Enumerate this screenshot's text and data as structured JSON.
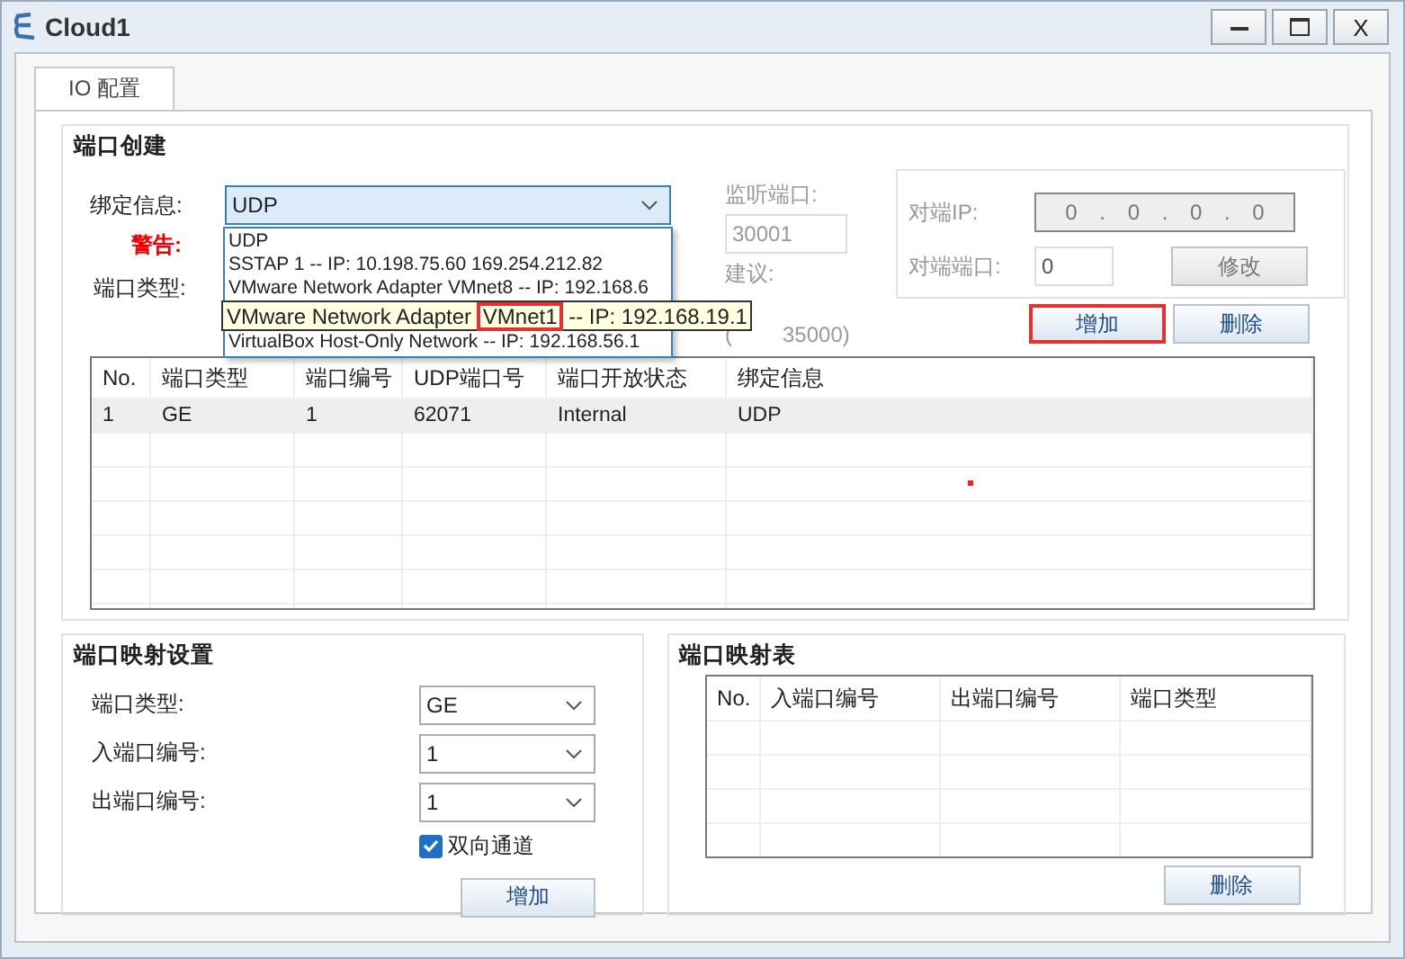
{
  "window": {
    "title": "Cloud1",
    "close_label": "X"
  },
  "tabs": [
    {
      "label": "IO 配置",
      "selected": true
    }
  ],
  "port_creation": {
    "title": "端口创建",
    "binding": {
      "label": "绑定信息:",
      "value": "UDP",
      "expanded": true,
      "options": [
        "UDP",
        "SSTAP 1 -- IP: 10.198.75.60 169.254.212.82",
        "VMware Network Adapter VMnet8 -- IP: 192.168.6",
        "VirtualBox Host-Only Network -- IP: 192.168.56.1"
      ],
      "tooltip": [
        {
          "text": "VMware Network Adapter ",
          "highlighted": false
        },
        {
          "text": "VMnet1",
          "highlighted": true
        },
        {
          "text": " -- IP: 192.168.19.1",
          "highlighted": false
        }
      ]
    },
    "warning": "警告:",
    "port_type_label": "端口类型:",
    "listen": {
      "label": "监听端口:",
      "value": "30001",
      "hint_label": "建议:",
      "hint_parts": [
        "(",
        "35000)"
      ],
      "disabled": true
    },
    "peer_ip": {
      "label": "对端IP:",
      "octets": [
        "0",
        "0",
        "0",
        "0"
      ],
      "separator": ".",
      "disabled": true
    },
    "peer_port": {
      "label": "对端端口:",
      "value": "0",
      "disabled": true
    },
    "modify_button": {
      "label": "修改",
      "disabled": true
    },
    "add_button": {
      "label": "增加",
      "highlighted": true
    },
    "delete_button": {
      "label": "删除",
      "highlighted": false
    },
    "table": {
      "columns": [
        "No.",
        "端口类型",
        "端口编号",
        "UDP端口号",
        "端口开放状态",
        "绑定信息"
      ],
      "rows": [
        {
          "cells": [
            "1",
            "GE",
            "1",
            "62071",
            "Internal",
            "UDP"
          ],
          "selected": true
        }
      ]
    }
  },
  "port_mapping": {
    "title": "端口映射设置",
    "fields": [
      {
        "label": "端口类型:",
        "value": "GE"
      },
      {
        "label": "入端口编号:",
        "value": "1"
      },
      {
        "label": "出端口编号:",
        "value": "1"
      }
    ],
    "bidirectional": {
      "label": "双向通道",
      "checked": true
    },
    "add_button": "增加"
  },
  "mapping_table": {
    "title": "端口映射表",
    "columns": [
      "No.",
      "入端口编号",
      "出端口编号",
      "端口类型"
    ],
    "delete_button": "删除"
  }
}
